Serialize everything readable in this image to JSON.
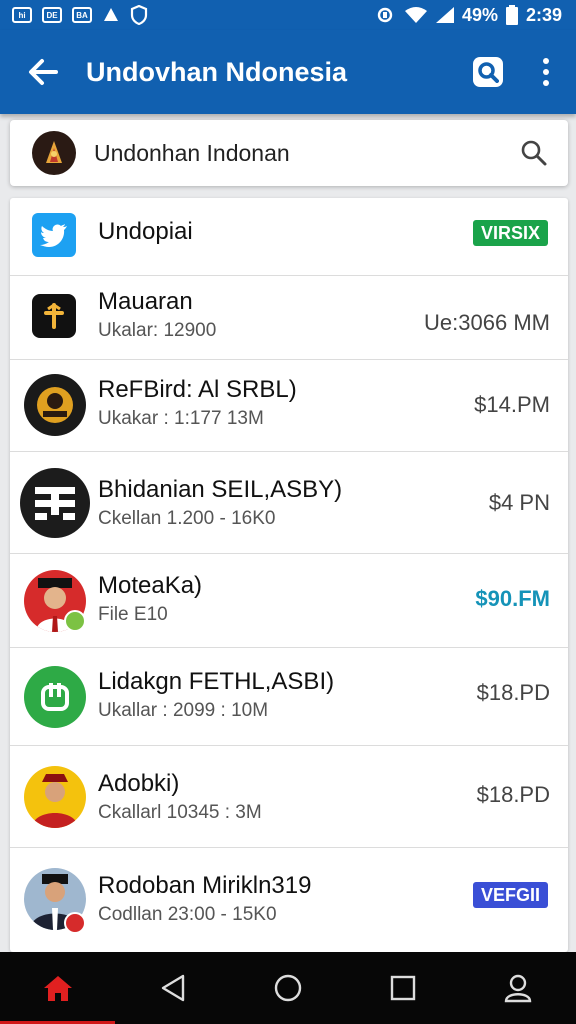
{
  "status_bar": {
    "notifications": [
      "hi",
      "DE",
      "BA"
    ],
    "battery": "49%",
    "time": "2:39"
  },
  "app_bar": {
    "title": "Undovhan Ndonesia"
  },
  "search": {
    "value": "Undonhan Indonan"
  },
  "list": [
    {
      "title": "Undopiai",
      "badge": "VIRSIX",
      "badge_color": "#1aa34a"
    },
    {
      "title": "Mauaran",
      "subtitle": "Ukalar: 12900",
      "value": "Ue:3066 MM"
    },
    {
      "title": "ReFBird: Al SRBL)",
      "subtitle": "Ukakar : 1:177 13M",
      "value": "$14.PM"
    },
    {
      "title": "Bhidanian SEIL,ASBY)",
      "subtitle": "Ckellan 1.200 - 16K0",
      "value": "$4 PN"
    },
    {
      "title": "MoteaKa)",
      "subtitle": "File E10",
      "value": "$90.FM",
      "value_color": "#1593b8"
    },
    {
      "title": "Lidakgn FETHL,ASBI)",
      "subtitle": "Ukallar : 2099 : 10M",
      "value": "$18.PD"
    },
    {
      "title": "Adobki)",
      "subtitle": "Ckallarl 10345 : 3M",
      "value": "$18.PD"
    },
    {
      "title": "Rodoban Mirikln319",
      "subtitle": "Codllan 23:00 - 15K0",
      "badge": "VEFGII",
      "badge_color": "#3a4fd6"
    }
  ],
  "colors": {
    "primary": "#1160b0",
    "nav_active": "#d01818"
  }
}
